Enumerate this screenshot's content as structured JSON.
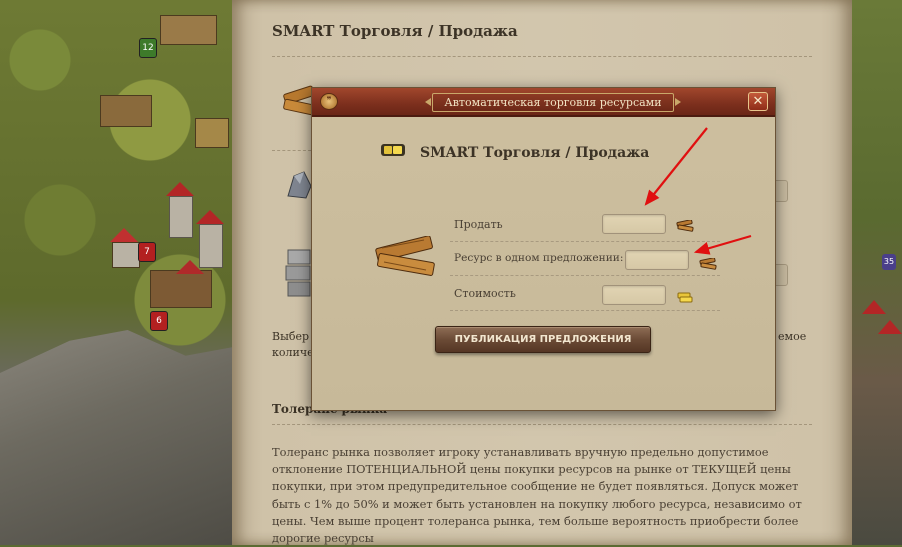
{
  "article": {
    "title": "SMART Торговля / Продажа",
    "fragment_left_1": "Выбер",
    "fragment_left_2": "количе",
    "fragment_right": "емое",
    "tolerance_heading": "Толеранс рынка",
    "tolerance_text": "Толеранс рынка позволяет игроку устанавливать вручную предельно допустимое отклонение ПОТЕНЦИАЛЬНОЙ цены покупки ресурсов на рынке от ТЕКУЩЕЙ цены покупки, при этом предупредительное сообщение не будет появляться. Допуск может быть с 1% до 50% и может быть установлен на покупку любого ресурса, независимо от цены. Чем выше процент толеранса рынка, тем больше вероятность приобрести более дорогие ресурсы"
  },
  "modal": {
    "title": "Автоматическая торговля ресурсами",
    "subtitle": "SMART Торговля / Продажа",
    "close_label": "✕",
    "fields": [
      {
        "label": "Продать",
        "value": "",
        "icon": "wood-icon"
      },
      {
        "label": "Ресурс в одном предложении:",
        "value": "",
        "icon": "wood-icon"
      },
      {
        "label": "Стоимость",
        "value": "",
        "icon": "gold-icon"
      }
    ],
    "publish_label": "ПУБЛИКАЦИЯ ПРЕДЛОЖЕНИЯ"
  },
  "map_badges": {
    "left": [
      "12",
      "7",
      "6"
    ],
    "right": [
      "35"
    ]
  },
  "colors": {
    "arrow": "#e01010",
    "modal_bar": "#7c2f1d",
    "parchment": "#d2c6ad",
    "publish_button": "#6b4b36"
  }
}
